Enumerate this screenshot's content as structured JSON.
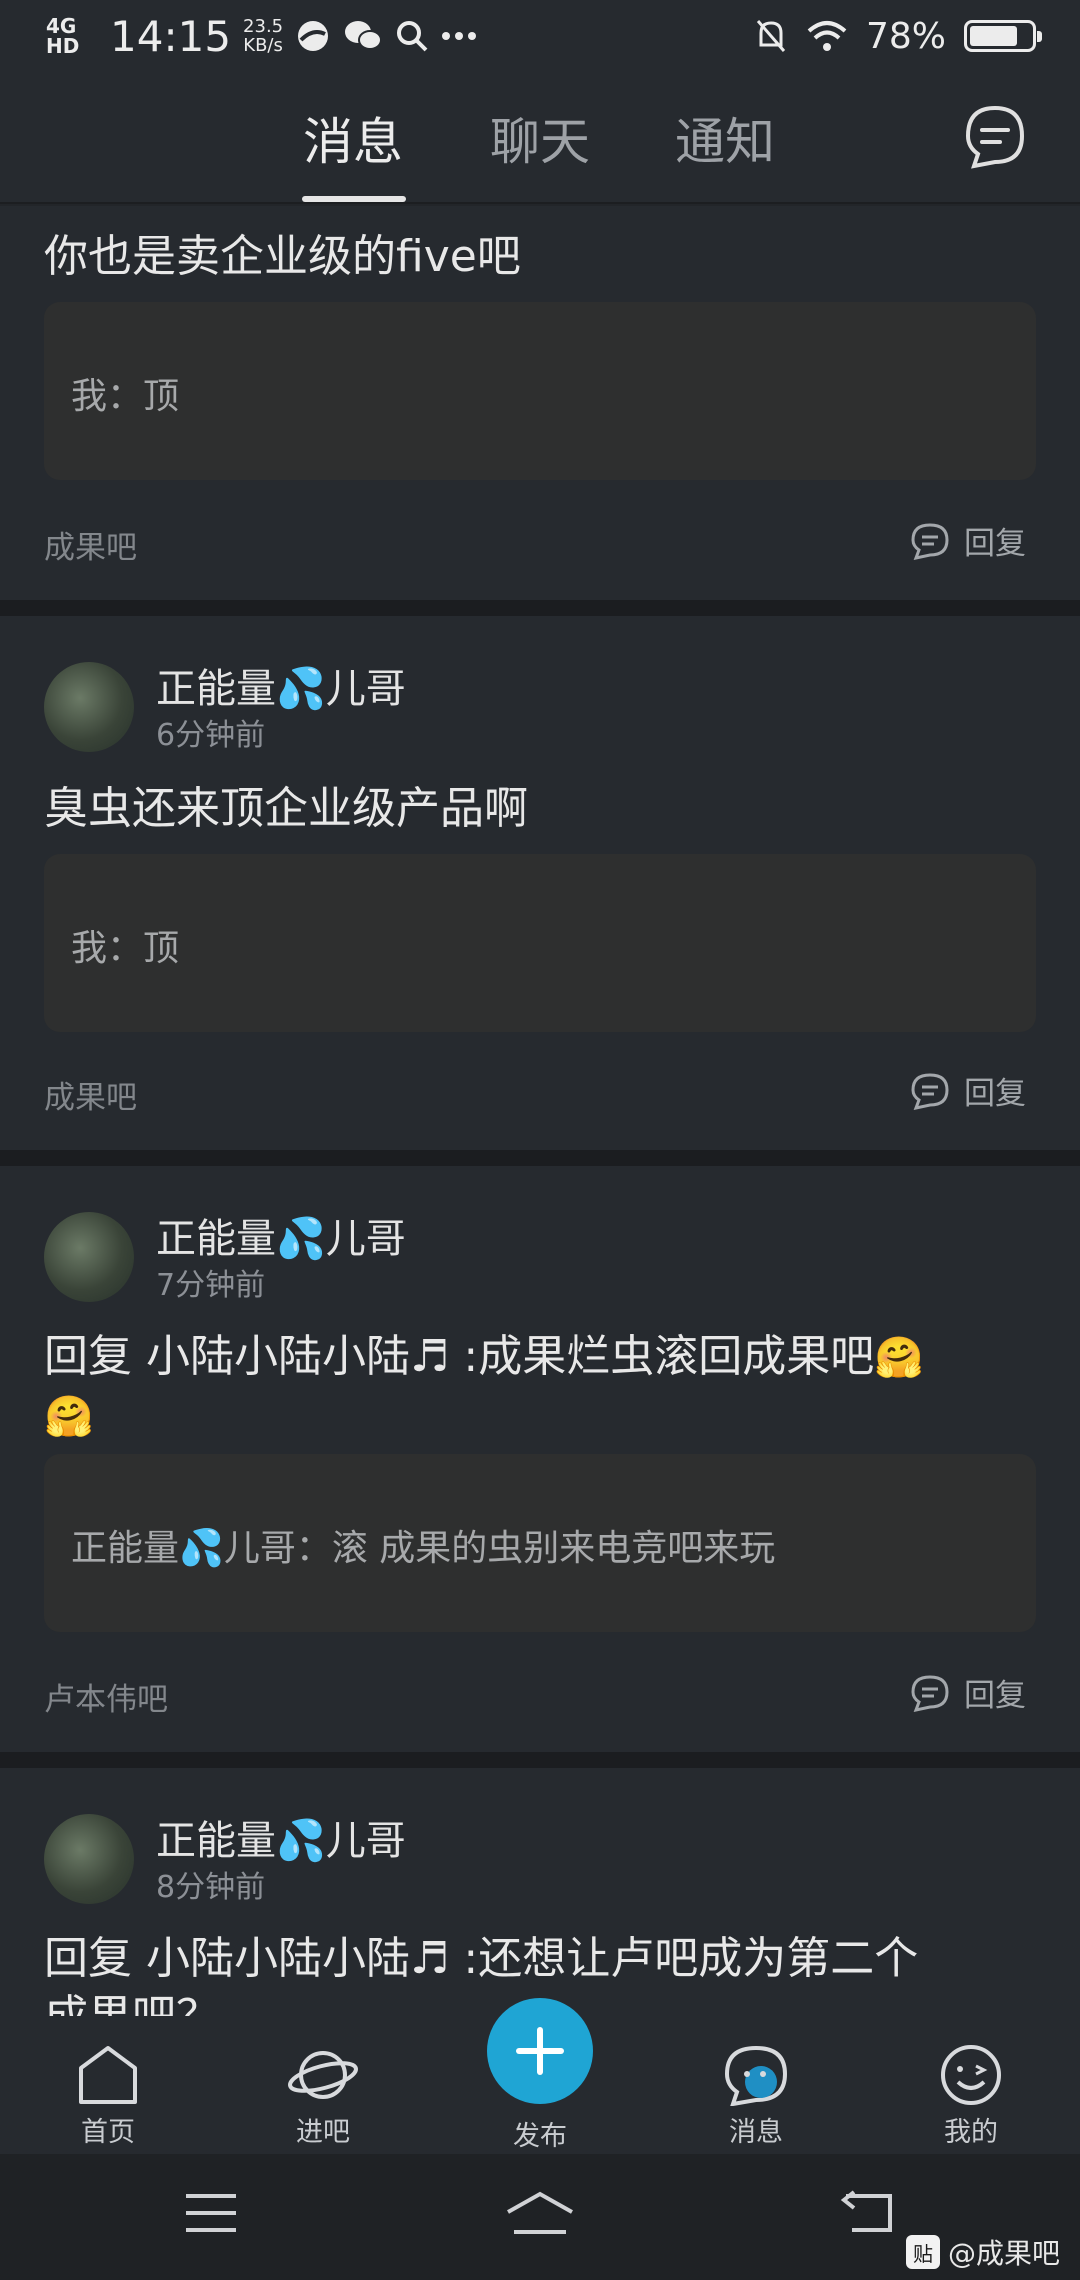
{
  "status_bar": {
    "network": "4G HD",
    "time": "14:15",
    "speed_value": "23.5",
    "speed_unit": "KB/s",
    "battery": "78%",
    "battery_level": 0.78
  },
  "tabs": [
    {
      "label": "消息",
      "active": true
    },
    {
      "label": "聊天",
      "active": false
    },
    {
      "label": "通知",
      "active": false
    }
  ],
  "feed": [
    {
      "title": "你也是卖企业级的five吧",
      "quote": "我：顶",
      "forum": "成果吧",
      "reply_label": "回复"
    },
    {
      "username": "正能量💦儿哥",
      "time": "6分钟前",
      "title": "臭虫还来顶企业级产品啊",
      "quote": "我：顶",
      "forum": "成果吧",
      "reply_label": "回复"
    },
    {
      "username": "正能量💦儿哥",
      "time": "7分钟前",
      "title_line1": "回复 小陆小陆小陆♬ :成果烂虫滚回成果吧",
      "quote": "正能量💦儿哥：滚 成果的虫别来电竞吧来玩",
      "forum": "卢本伟吧",
      "reply_label": "回复"
    },
    {
      "username": "正能量💦儿哥",
      "time": "8分钟前",
      "title_line1": "回复 小陆小陆小陆♬ :还想让卢吧成为第二个",
      "title_line2": "成果吧？"
    }
  ],
  "bottom_nav": [
    {
      "label": "首页",
      "icon": "home-icon"
    },
    {
      "label": "进吧",
      "icon": "planet-icon"
    },
    {
      "label": "发布",
      "icon": "plus-icon"
    },
    {
      "label": "消息",
      "icon": "message-bubble-icon"
    },
    {
      "label": "我的",
      "icon": "face-icon"
    }
  ],
  "watermark": {
    "badge": "贴",
    "text": "@成果吧"
  }
}
